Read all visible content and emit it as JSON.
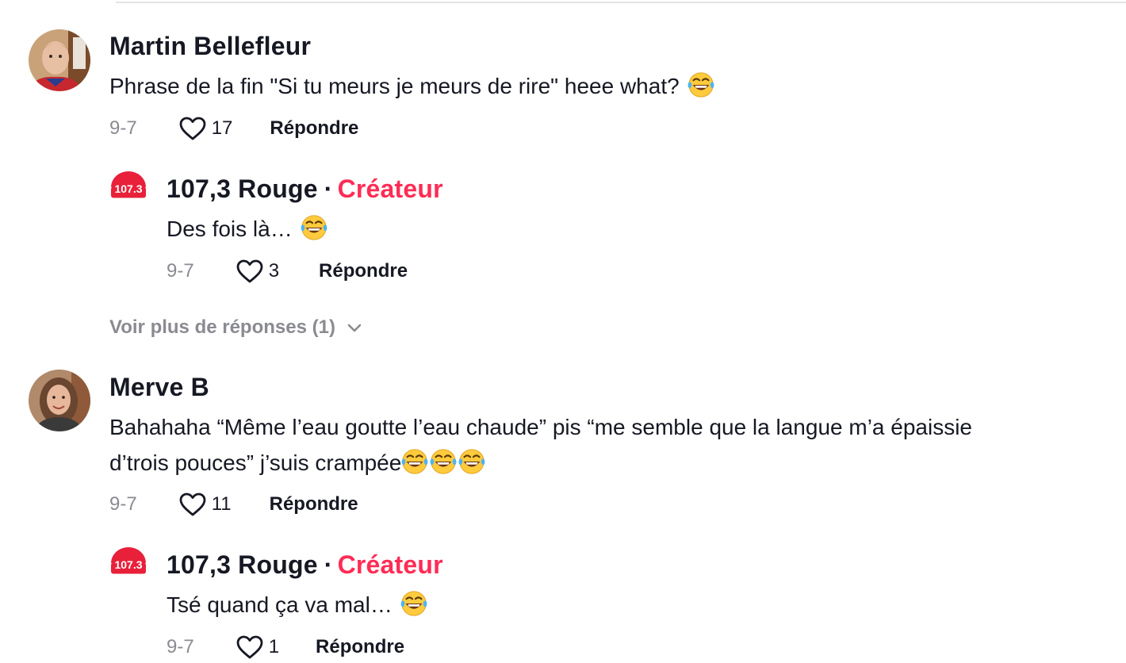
{
  "icons": {
    "like": "heart-outline-icon",
    "expand": "chevron-down-icon",
    "emoji": "face-with-tears-of-joy-emoji"
  },
  "colors": {
    "creator_accent": "#fe2c55",
    "muted": "#8a8b91",
    "text": "#161823"
  },
  "comments": [
    {
      "author": "Martin Bellefleur",
      "text": "Phrase de la fin \"Si tu meurs je meurs de rire\" heee what?",
      "date": "9-7",
      "likes": "17",
      "reply_label": "Répondre",
      "reply": {
        "logo_text": "107.3",
        "author": "107,3 Rouge",
        "separator": "·",
        "badge": "Créateur",
        "text": "Des fois là…",
        "date": "9-7",
        "likes": "3",
        "reply_label": "Répondre"
      },
      "more_replies": "Voir plus de réponses (1)"
    },
    {
      "author": "Merve B",
      "text_line1": "Bahahaha “Même l’eau goutte l’eau chaude” pis “me semble que la langue m’a épaissie",
      "text_line2": "d’trois pouces” j’suis crampée",
      "date": "9-7",
      "likes": "11",
      "reply_label": "Répondre",
      "reply": {
        "logo_text": "107.3",
        "author": "107,3 Rouge",
        "separator": "·",
        "badge": "Créateur",
        "text": "Tsé quand ça va mal…",
        "date": "9-7",
        "likes": "1",
        "reply_label": "Répondre"
      }
    }
  ]
}
